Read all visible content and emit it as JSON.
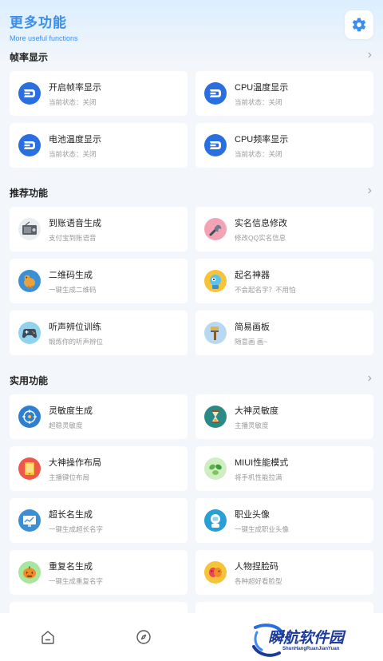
{
  "header": {
    "title": "更多功能",
    "subtitle": "More useful functions"
  },
  "sections": {
    "frame": {
      "title": "帧率显示",
      "items": [
        {
          "name": "开启帧率显示",
          "desc": "当前状态：关闭",
          "icon": "dash-icon"
        },
        {
          "name": "CPU温度显示",
          "desc": "当前状态：关闭",
          "icon": "dash-icon"
        },
        {
          "name": "电池温度显示",
          "desc": "当前状态：关闭",
          "icon": "dash-icon"
        },
        {
          "name": "CPU频率显示",
          "desc": "当前状态：关闭",
          "icon": "dash-icon"
        }
      ]
    },
    "recommend": {
      "title": "推荐功能",
      "items": [
        {
          "name": "到账语音生成",
          "desc": "支付宝到账语音",
          "icon": "radio-icon"
        },
        {
          "name": "实名信息修改",
          "desc": "修改QQ实名信息",
          "icon": "wrench-icon"
        },
        {
          "name": "二维码生成",
          "desc": "一键生成二维码",
          "icon": "dog-icon"
        },
        {
          "name": "起名神器",
          "desc": "不会起名字？不用怕",
          "icon": "robot-icon"
        },
        {
          "name": "听声辨位训练",
          "desc": "锻炼你的听声辨位",
          "icon": "gamepad-icon"
        },
        {
          "name": "简易画板",
          "desc": "随意画 画~",
          "icon": "brush-icon"
        }
      ]
    },
    "practical": {
      "title": "实用功能",
      "items": [
        {
          "name": "灵敏度生成",
          "desc": "超稳灵敏度",
          "icon": "target-icon"
        },
        {
          "name": "大神灵敏度",
          "desc": "主播灵敏度",
          "icon": "hourglass-icon"
        },
        {
          "name": "大神操作布局",
          "desc": "主播键位布局",
          "icon": "tablet-icon"
        },
        {
          "name": "MIUI性能模式",
          "desc": "将手机性能拉满",
          "icon": "leaves-icon"
        },
        {
          "name": "超长名生成",
          "desc": "一键生成超长名字",
          "icon": "monitor-chart-icon"
        },
        {
          "name": "职业头像",
          "desc": "一键生成职业头像",
          "icon": "astronaut-icon"
        },
        {
          "name": "重复名生成",
          "desc": "一键生成重复名字",
          "icon": "pumpkin-icon"
        },
        {
          "name": "人物捏脸码",
          "desc": "各种超好看脸型",
          "icon": "masks-icon"
        }
      ]
    }
  },
  "watermark": {
    "text": "瞬航软件园",
    "sub": "ShunHangRuanJianYuan"
  },
  "colors": {
    "accent": "#3a8ef0",
    "dash_blue": "#2a6fe0",
    "card_bg": "#ffffff",
    "page_bg": "#f3f6fa"
  }
}
